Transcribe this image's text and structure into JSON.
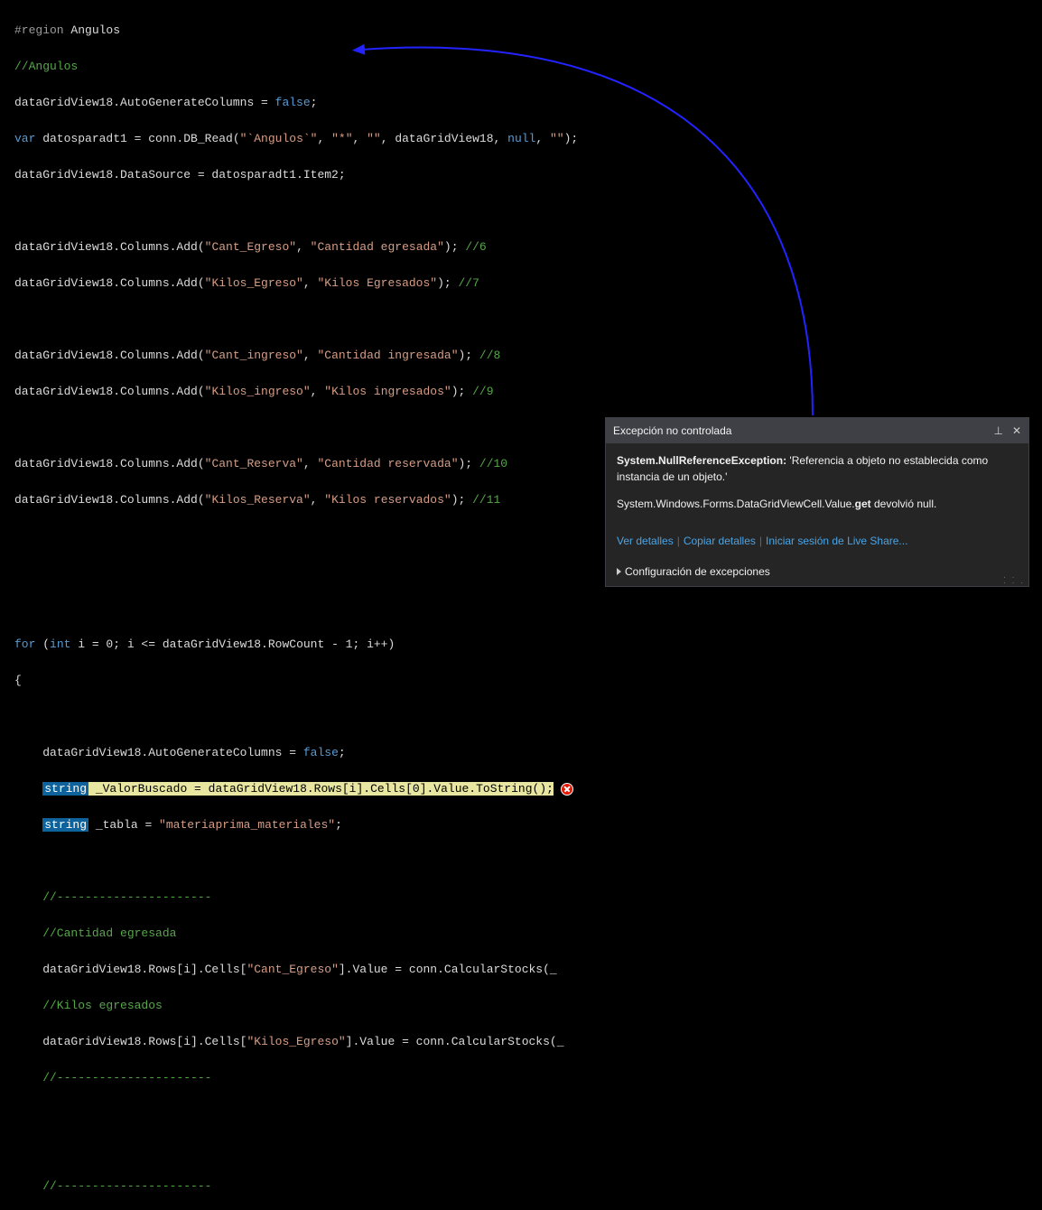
{
  "code": {
    "l1_region": "#region",
    "l1_name": " Angulos",
    "l2": "//Angulos",
    "l3a": "dataGridView18.AutoGenerateColumns = ",
    "l3b": "false",
    "l3c": ";",
    "l4a": "var",
    "l4b": " datosparadt1 = conn.DB_Read(",
    "l4c": "\"`Angulos`\"",
    "l4d": ", ",
    "l4e": "\"*\"",
    "l4f": ", ",
    "l4g": "\"\"",
    "l4h": ", dataGridView18, ",
    "l4i": "null",
    "l4j": ", ",
    "l4k": "\"\"",
    "l4l": ");",
    "l5": "dataGridView18.DataSource = datosparadt1.Item2;",
    "l7a": "dataGridView18.Columns.Add(",
    "l7b": "\"Cant_Egreso\"",
    "l7c": ", ",
    "l7d": "\"Cantidad egresada\"",
    "l7e": "); ",
    "l7f": "//6",
    "l8a": "dataGridView18.Columns.Add(",
    "l8b": "\"Kilos_Egreso\"",
    "l8c": ", ",
    "l8d": "\"Kilos Egresados\"",
    "l8e": "); ",
    "l8f": "//7",
    "l10a": "dataGridView18.Columns.Add(",
    "l10b": "\"Cant_ingreso\"",
    "l10c": ", ",
    "l10d": "\"Cantidad ingresada\"",
    "l10e": "); ",
    "l10f": "//8",
    "l11a": "dataGridView18.Columns.Add(",
    "l11b": "\"Kilos_ingreso\"",
    "l11c": ", ",
    "l11d": "\"Kilos ingresados\"",
    "l11e": "); ",
    "l11f": "//9",
    "l13a": "dataGridView18.Columns.Add(",
    "l13b": "\"Cant_Reserva\"",
    "l13c": ", ",
    "l13d": "\"Cantidad reservada\"",
    "l13e": "); ",
    "l13f": "//10",
    "l14a": "dataGridView18.Columns.Add(",
    "l14b": "\"Kilos_Reserva\"",
    "l14c": ", ",
    "l14d": "\"Kilos reservados\"",
    "l14e": "); ",
    "l14f": "//11",
    "for_a": "for",
    "for_b": " (",
    "for_c": "int",
    "for_d": " i = 0; i <= dataGridView18.RowCount - 1; i++)",
    "brace_open": "{",
    "inner1a": "    dataGridView18.AutoGenerateColumns = ",
    "inner1b": "false",
    "inner1c": ";",
    "inner2_kw": "string",
    "inner2_hl": " _ValorBuscado = dataGridView18.Rows[i].Cells[0].Value.ToString();",
    "inner3_kw": "string",
    "inner3a": " _tabla = ",
    "inner3b": "\"materiaprima_materiales\"",
    "inner3c": ";",
    "dash1": "    //----------------------",
    "cmt1": "    //Cantidad egresada",
    "stk1a": "    dataGridView18.Rows[i].Cells[",
    "stk1b": "\"Cant_Egreso\"",
    "stk1c": "].Value = conn.CalcularStocks(_",
    "cmt2": "    //Kilos egresados",
    "stk2a": "    dataGridView18.Rows[i].Cells[",
    "stk2b": "\"Kilos_Egreso\"",
    "stk2c": "].Value = conn.CalcularStocks(_",
    "dash2": "    //----------------------",
    "dash3": "    //----------------------"
  },
  "exception": {
    "title": "Excepción no controlada",
    "msg_bold": "System.NullReferenceException: ",
    "msg_rest": "'Referencia a objeto no establecida como instancia de un objeto.'",
    "detail_pre": "System.Windows.Forms.DataGridViewCell.Value.",
    "detail_bold": "get",
    "detail_post": " devolvió null.",
    "link1": "Ver detalles",
    "link2": "Copiar detalles",
    "link3": "Iniciar sesión de Live Share...",
    "footer": "Configuración de excepciones"
  }
}
